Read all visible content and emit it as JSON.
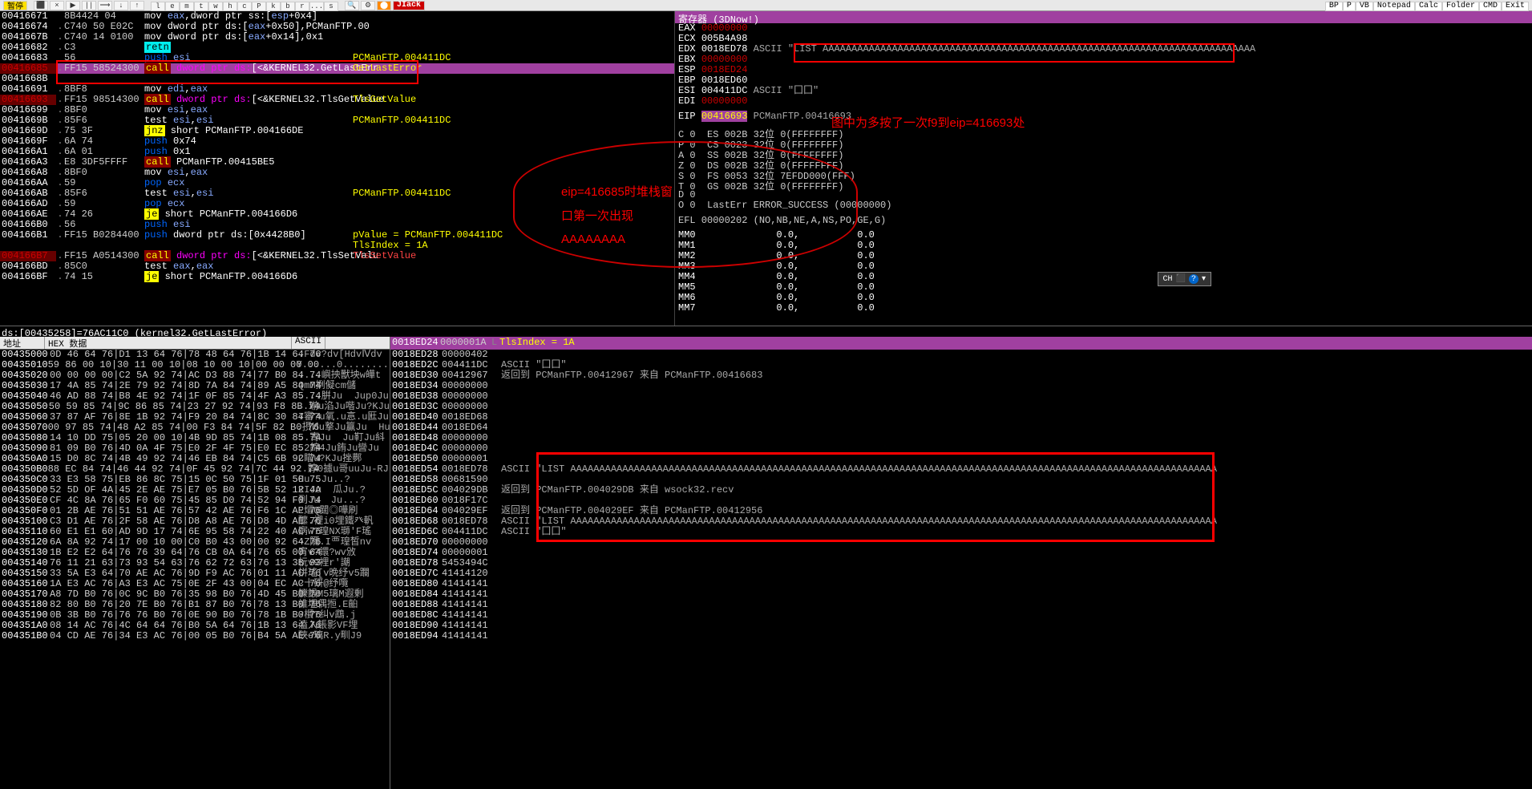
{
  "toolbar": {
    "pause": "暂停",
    "letters": [
      "l",
      "e",
      "m",
      "t",
      "w",
      "h",
      "c",
      "P",
      "k",
      "b",
      "r",
      "...",
      "s"
    ],
    "ext": [
      "BP",
      "P",
      "VB",
      "Notepad",
      "Calc",
      "Folder",
      "CMD",
      "Exit"
    ],
    "hijack": "JIack"
  },
  "disasm": [
    {
      "a": "00416671",
      "m": "",
      "b": "8B4424 04",
      "i": "mov eax,dword ptr ss:[esp+0x4]"
    },
    {
      "a": "00416674",
      "m": ".",
      "b": "C740 50 E02C",
      "i": "mov dword ptr ds:[eax+0x50],PCManFTP.00"
    },
    {
      "a": "0041667B",
      "m": ".",
      "b": "C740 14 0100",
      "i": "mov dword ptr ds:[eax+0x14],0x1"
    },
    {
      "a": "00416682",
      "m": ".",
      "b": "C3",
      "i": "retn",
      "retn": true
    },
    {
      "a": "00416683",
      "m": "",
      "b": "56",
      "i": "push esi",
      "push": true,
      "cmt": "PCManFTP.004411DC"
    },
    {
      "a": "00416685",
      "m": ".",
      "b": "FF15 58524300",
      "i": "call dword ptr ds:[<&KERNEL32.GetLastErr",
      "call": true,
      "hl": true,
      "cmt": "GetLastError",
      "ar": true
    },
    {
      "a": "0041668B",
      "m": "",
      "b": "",
      "i": ""
    },
    {
      "a": "00416691",
      "m": ".",
      "b": "8BF8",
      "i": "mov edi,eax"
    },
    {
      "a": "00416693",
      "m": ".",
      "b": "FF15 98514300",
      "i": "call dword ptr ds:[<&KERNEL32.TlsGetValue",
      "call": true,
      "ar": true,
      "cmt": "TlsGetValue"
    },
    {
      "a": "00416699",
      "m": ".",
      "b": "8BF0",
      "i": "mov esi,eax"
    },
    {
      "a": "0041669B",
      "m": ".",
      "b": "85F6",
      "i": "test esi,esi",
      "cmt": "PCManFTP.004411DC"
    },
    {
      "a": "0041669D",
      "m": ".",
      "b": "75 3F",
      "i": "jnz short PCManFTP.004166DE",
      "jmp": true
    },
    {
      "a": "0041669F",
      "m": ".",
      "b": "6A 74",
      "i": "push 0x74",
      "push": true
    },
    {
      "a": "004166A1",
      "m": ".",
      "b": "6A 01",
      "i": "push 0x1",
      "push": true
    },
    {
      "a": "004166A3",
      "m": ".",
      "b": "E8 3DF5FFFF",
      "i": "call PCManFTP.00415BE5",
      "call": true
    },
    {
      "a": "004166A8",
      "m": ".",
      "b": "8BF0",
      "i": "mov esi,eax"
    },
    {
      "a": "004166AA",
      "m": ".",
      "b": "59",
      "i": "pop ecx",
      "pop": true
    },
    {
      "a": "004166AB",
      "m": ".",
      "b": "85F6",
      "i": "test esi,esi",
      "cmt": "PCManFTP.004411DC"
    },
    {
      "a": "004166AD",
      "m": ".",
      "b": "59",
      "i": "pop ecx",
      "pop": true
    },
    {
      "a": "004166AE",
      "m": ".",
      "b": "74 26",
      "i": "je short PCManFTP.004166D6",
      "jmp": true
    },
    {
      "a": "004166B0",
      "m": ".",
      "b": "56",
      "i": "push esi",
      "push": true
    },
    {
      "a": "004166B1",
      "m": ".",
      "b": "FF15 B0284400",
      "i": "push dword ptr ds:[0x4428B0]",
      "push": true,
      "cmt": "pValue = PCManFTP.004411DC"
    },
    {
      "a": "",
      "m": "",
      "b": "",
      "i": "",
      "cmt": "TlsIndex = 1A"
    },
    {
      "a": "004166B7",
      "m": ".",
      "b": "FF15 A0514300",
      "i": "call dword ptr ds:[<&KERNEL32.TlsSetValu",
      "call": true,
      "ar": true,
      "cmt": "TlsSetValue",
      "cmtred": true
    },
    {
      "a": "004166BD",
      "m": ".",
      "b": "85C0",
      "i": "test eax,eax"
    },
    {
      "a": "004166BF",
      "m": ".",
      "b": "74 15",
      "i": "je short PCManFTP.004166D6",
      "jmp": true
    }
  ],
  "info_line": "ds:[00435258]=76AC11C0 (kernel32.GetLastError)",
  "registers": {
    "title": "寄存器 (3DNow!)",
    "rows": [
      {
        "n": "EAX",
        "v": "00000000",
        "red": true
      },
      {
        "n": "ECX",
        "v": "005B4A98"
      },
      {
        "n": "EDX",
        "v": "0018ED78",
        "a": "ASCII \"LIST AAAAAAAAAAAAAAAAAAAAAAAAAAAAAAAAAAAAAAAAAAAAAAAAAAAAAAAAAAAAAAAAAAAAAAAAAAA"
      },
      {
        "n": "EBX",
        "v": "00000000",
        "red": true
      },
      {
        "n": "ESP",
        "v": "0018ED24",
        "red": true
      },
      {
        "n": "EBP",
        "v": "0018ED60"
      },
      {
        "n": "ESI",
        "v": "004411DC",
        "a": "ASCII \"囗囗\""
      },
      {
        "n": "EDI",
        "v": "00000000",
        "red": true
      }
    ],
    "eip": {
      "n": "EIP",
      "v": "00416693",
      "a": "PCManFTP.00416693",
      "hl": true
    },
    "flags": [
      "C 0  ES 002B 32位 0(FFFFFFFF)",
      "P 0  CS 0023 32位 0(FFFFFFFF)",
      "A 0  SS 002B 32位 0(FFFFFFFF)",
      "Z 0  DS 002B 32位 0(FFFFFFFF)",
      "S 0  FS 0053 32位 7EFDD000(FFF)",
      "T 0  GS 002B 32位 0(FFFFFFFF)",
      "D 0",
      "O 0  LastErr ERROR_SUCCESS (00000000)"
    ],
    "efl": "EFL 00000202 (NO,NB,NE,A,NS,PO,GE,G)",
    "mm": [
      {
        "n": "MM0",
        "v": "0.0,",
        "v2": "0.0"
      },
      {
        "n": "MM1",
        "v": "0.0,",
        "v2": "0.0"
      },
      {
        "n": "MM2",
        "v": "0.0,",
        "v2": "0.0"
      },
      {
        "n": "MM3",
        "v": "0.0,",
        "v2": "0.0"
      },
      {
        "n": "MM4",
        "v": "0.0,",
        "v2": "0.0"
      },
      {
        "n": "MM5",
        "v": "0.0,",
        "v2": "0.0"
      },
      {
        "n": "MM6",
        "v": "0.0,",
        "v2": "0.0"
      },
      {
        "n": "MM7",
        "v": "0.0,",
        "v2": "0.0"
      }
    ]
  },
  "dump_header": {
    "addr": "地址",
    "hex": "HEX 数据",
    "ascii": "ASCII"
  },
  "dump": [
    {
      "a": "00435000",
      "h": "0D 46 64 76|D1 13 64 76|78 48 64 76|1B 14 64 76",
      "s": ".Fdv?dv[HdvⅣdv"
    },
    {
      "a": "00435010",
      "h": "59 86 00 10|30 11 00 10|08 10 00 10|00 00 00 00",
      "s": "Y......0.........."
    },
    {
      "a": "00435020",
      "h": "00 00 00 00|C2 5A 92 74|AC D3 88 74|77 B0 84 74",
      "s": "....嶼抰獸坱w皣t"
    },
    {
      "a": "00435030",
      "h": "17 4A 85 74|2E 79 92 74|8D 7A 84 74|89 A5 84 74",
      "s": "QmM挒儗cm儲"
    },
    {
      "a": "00435040",
      "h": "46 AD 88 74|B8 4E 92 74|1F 0F 85 74|4F A3 85 74",
      "s": "....腁Ju  Jup0Ju"
    },
    {
      "a": "00435050",
      "h": "50 59 85 74|9C 86 85 74|23 27 92 74|93 F8 8B 74",
      "s": "..瑐u淊Ju喈Ju?KJu"
    },
    {
      "a": "00435060",
      "h": "37 87 AF 76|8E 1B 92 74|F9 20 84 74|8C 30 84 74",
      "s": "7審?u氧.u悥.u匨Ju"
    },
    {
      "a": "00435070",
      "h": "00 97 85 74|48 A2 85 74|00 F3 84 74|5F 82 B0 76",
      "s": ".摂Ͷu撉Ju籯Ju  Hu鄸"
    },
    {
      "a": "00435080",
      "h": "14 10 DD 75|05 20 00 10|4B 9D 85 74|1B 08 85 74",
      "s": "..寈Ju  Ju靪Ju紏"
    },
    {
      "a": "00435090",
      "h": "81 09 B0 76|4D 0A 4F 75|E0 2F 4F 75|E0 EC 85 74",
      "s": ".2鍗4Ju銪Ju曫Ju"
    },
    {
      "a": "004350A0",
      "h": "15 D0 8C 74|4B 49 92 74|46 EB 84 74|C5 6B 92 74",
      "s": "C瞄u?KJu挫鄸"
    },
    {
      "a": "004350B0",
      "h": "88 EC 84 74|46 44 92 74|0F 45 92 74|7C 44 92 74",
      "s": "..朜0攄u哥uuJu-RJu"
    },
    {
      "a": "004350C0",
      "h": "33 E3 58 75|EB 86 8C 75|15 0C 50 75|1F 01 50 75",
      "s": "Hu  Ju..?"
    },
    {
      "a": "004350D0",
      "h": "52 5D OF 4A|45 2E AE 75|E7 05 B0 76|5B 52 12 4A",
      "s": "RIJu  瓜Ju.?"
    },
    {
      "a": "004350E0",
      "h": "CF 4C 8A 76|65 F0 60 75|45 85 D0 74|52 94 F0 74",
      "s": "到Ju  Ju...?"
    },
    {
      "a": "004350F0",
      "h": "01 2B AE 76|51 51 AE 76|57 42 AE 76|F6 1C AE 76",
      "s": "?熰Q閮◎嘩刷"
    },
    {
      "a": "00435100",
      "h": "C3 D1 AE 76|2F 58 AE 76|D8 A8 AE 76|D8 4D AE 76",
      "s": "醿.裡i0埋鐵癶軓"
    },
    {
      "a": "00435110",
      "h": "60 E1 E1 60|AD 9D 17 74|6E 95 58 74|22 40 AC 76",
      "s": "寎w?瑝NX瑡'F瑤"
    },
    {
      "a": "00435120",
      "h": "6A 8A 92 74|17 00 10 00|C0 B0 43 00|00 92 64 76",
      "s": "^Z隬.I覀瑝皙nv"
    },
    {
      "a": "00435130",
      "h": "1B E2 E2 64|76 76 39 64|76 CB 0A 64|76 65 00 64",
      "s": "宵v?鐶?wv攽"
    },
    {
      "a": "00435140",
      "h": "76 11 21 63|73 93 54 63|76 62 72 63|76 13 3B 93",
      "s": "杬v9裡r'謿"
    },
    {
      "a": "00435150",
      "h": "33 5A E3 64|70 AE AC 76|9D F9 AC 76|01 11 AC 76",
      "s": "拼瑤[v晩纾v5躝"
    },
    {
      "a": "00435160",
      "h": "1A E3 AC 76|A3 E3 AC 75|0E 2F 43 00|04 EC AC 76",
      "s": "?十研@纾囕"
    },
    {
      "a": "00435170",
      "h": "A8 7D B0 76|0C 9C B0 76|35 98 B0 76|4D 45 B0 76",
      "s": "觻餱M5璃M遐剰"
    },
    {
      "a": "00435180",
      "h": "82 80 B0 76|20 7E B0 76|B1 87 B0 76|78 13 B0 76",
      "s": "誰埋偶搄.E齨"
    },
    {
      "a": "00435190",
      "h": "0B 3B B0 76|76 76 B0 76|0E 90 B0 76|78 1B B0 76",
      "s": "?橮?纠v鵡.j"
    },
    {
      "a": "004351A0",
      "h": "08 14 AC 76|4C 64 64 76|B0 5A 64 76|1B 13 64 76",
      "s": "溘入韔影VF埋"
    },
    {
      "a": "004351B0",
      "h": "04 CD AE 76|34 E3 AC 76|00 05 B0 76|B4 5A AE 76",
      "s": "硤e璃R.y甽J9"
    }
  ],
  "stack_header": {
    "first": "0018ED24",
    "val": "0000001A",
    "cmt": "TlsIndex = 1A"
  },
  "stack": [
    {
      "a": "0018ED28",
      "v": "00000402"
    },
    {
      "a": "0018ED2C",
      "v": "004411DC",
      "c": "ASCII \"囗囗\""
    },
    {
      "a": "0018ED30",
      "v": "00412967",
      "c": "返回到 PCManFTP.00412967 来自 PCManFTP.00416683"
    },
    {
      "a": "0018ED34",
      "v": "00000000"
    },
    {
      "a": "0018ED38",
      "v": "00000000"
    },
    {
      "a": "0018ED3C",
      "v": "00000000"
    },
    {
      "a": "0018ED40",
      "v": "0018ED68"
    },
    {
      "a": "0018ED44",
      "v": "0018ED64"
    },
    {
      "a": "0018ED48",
      "v": "00000000"
    },
    {
      "a": "0018ED4C",
      "v": "00000000"
    },
    {
      "a": "0018ED50",
      "v": "00000001"
    },
    {
      "a": "0018ED54",
      "v": "0018ED78",
      "c": "ASCII \"LIST AAAAAAAAAAAAAAAAAAAAAAAAAAAAAAAAAAAAAAAAAAAAAAAAAAAAAAAAAAAAAAAAAAAAAAAAAAAAAAAAAAAAAAAAAAAAAAAAAAAAAAAAAAAAAAAA"
    },
    {
      "a": "0018ED58",
      "v": "00681590"
    },
    {
      "a": "0018ED5C",
      "v": "004029DB",
      "c": "返回到 PCManFTP.004029DB 来自 wsock32.recv"
    },
    {
      "a": "0018ED60",
      "v": "0018F17C"
    },
    {
      "a": "0018ED64",
      "v": "004029EF",
      "c": "返回到 PCManFTP.004029EF 来自 PCManFTP.00412956"
    },
    {
      "a": "0018ED68",
      "v": "0018ED78",
      "c": "ASCII \"LIST AAAAAAAAAAAAAAAAAAAAAAAAAAAAAAAAAAAAAAAAAAAAAAAAAAAAAAAAAAAAAAAAAAAAAAAAAAAAAAAAAAAAAAAAAAAAAAAAAAAAAAAAAAAAAAAA"
    },
    {
      "a": "0018ED6C",
      "v": "004411DC",
      "c": "ASCII \"囗囗\""
    },
    {
      "a": "0018ED70",
      "v": "00000000"
    },
    {
      "a": "0018ED74",
      "v": "00000001"
    },
    {
      "a": "0018ED78",
      "v": "5453494C"
    },
    {
      "a": "0018ED7C",
      "v": "41414120"
    },
    {
      "a": "0018ED80",
      "v": "41414141"
    },
    {
      "a": "0018ED84",
      "v": "41414141"
    },
    {
      "a": "0018ED88",
      "v": "41414141"
    },
    {
      "a": "0018ED8C",
      "v": "41414141"
    },
    {
      "a": "0018ED90",
      "v": "41414141"
    },
    {
      "a": "0018ED94",
      "v": "41414141"
    }
  ],
  "annotations": {
    "eip_note": "图中为多按了一次f9到eip=416693处",
    "bubble_l1": "eip=416685时堆栈窗",
    "bubble_l2": "口第一次出现",
    "bubble_l3": "AAAAAAAA",
    "cpu_tooltip": "CH"
  }
}
